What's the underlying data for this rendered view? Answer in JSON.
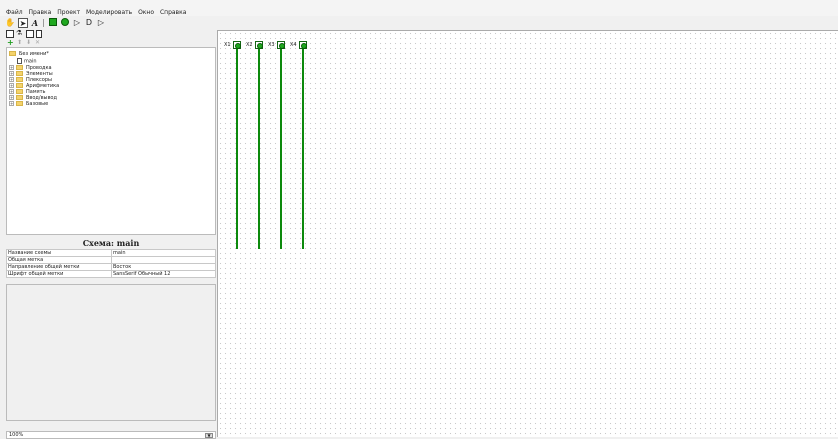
{
  "menu": [
    "Файл",
    "Правка",
    "Проект",
    "Моделировать",
    "Окно",
    "Справка"
  ],
  "toolbar": {
    "icons": [
      "hand-tool-icon",
      "select-arrow-icon",
      "text-tool-icon",
      "input-pin-icon",
      "output-pin-icon",
      "not-gate-icon",
      "and-gate-icon",
      "or-gate-icon"
    ],
    "text_tool": "A"
  },
  "tree": {
    "project": "Без имени*",
    "circuit": "main",
    "libraries": [
      "Проводка",
      "Элементы",
      "Плексоры",
      "Арифметика",
      "Память",
      "Ввод/вывод",
      "Базовые"
    ]
  },
  "props": {
    "title": "Схема: main",
    "rows": [
      {
        "key": "Название схемы",
        "value": "main"
      },
      {
        "key": "Общая метка",
        "value": ""
      },
      {
        "key": "Направление общей метки",
        "value": "Восток"
      },
      {
        "key": "Шрифт общей метки",
        "value": "SansSerif Обычный 12"
      }
    ]
  },
  "zoom": "100%",
  "canvas": {
    "pins": [
      {
        "label": "X1"
      },
      {
        "label": "X2"
      },
      {
        "label": "X3"
      },
      {
        "label": "X4"
      }
    ],
    "wire_color": "#0d8a0d"
  }
}
